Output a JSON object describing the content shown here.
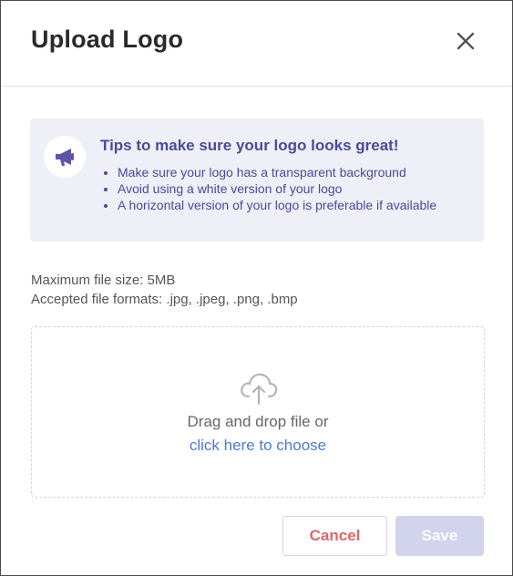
{
  "dialog": {
    "title": "Upload Logo"
  },
  "tips": {
    "icon": "megaphone-icon",
    "title": "Tips to make sure your logo looks great!",
    "items": [
      "Make sure your logo has a transparent background",
      "Avoid using a white version of your logo",
      "A horizontal version of your logo is preferable if available"
    ]
  },
  "file_info": {
    "max_size": "Maximum file size: 5MB",
    "formats": "Accepted file formats: .jpg, .jpeg, .png, .bmp"
  },
  "dropzone": {
    "icon": "cloud-upload-icon",
    "text": "Drag and drop file or",
    "link": "click here to choose"
  },
  "buttons": {
    "cancel": "Cancel",
    "save": "Save"
  },
  "colors": {
    "accent": "#4a4a9a",
    "link": "#4a7bd0",
    "cancel_text": "#e06666",
    "save_disabled": "#d2d3ec",
    "tips_background": "#efeff7"
  }
}
